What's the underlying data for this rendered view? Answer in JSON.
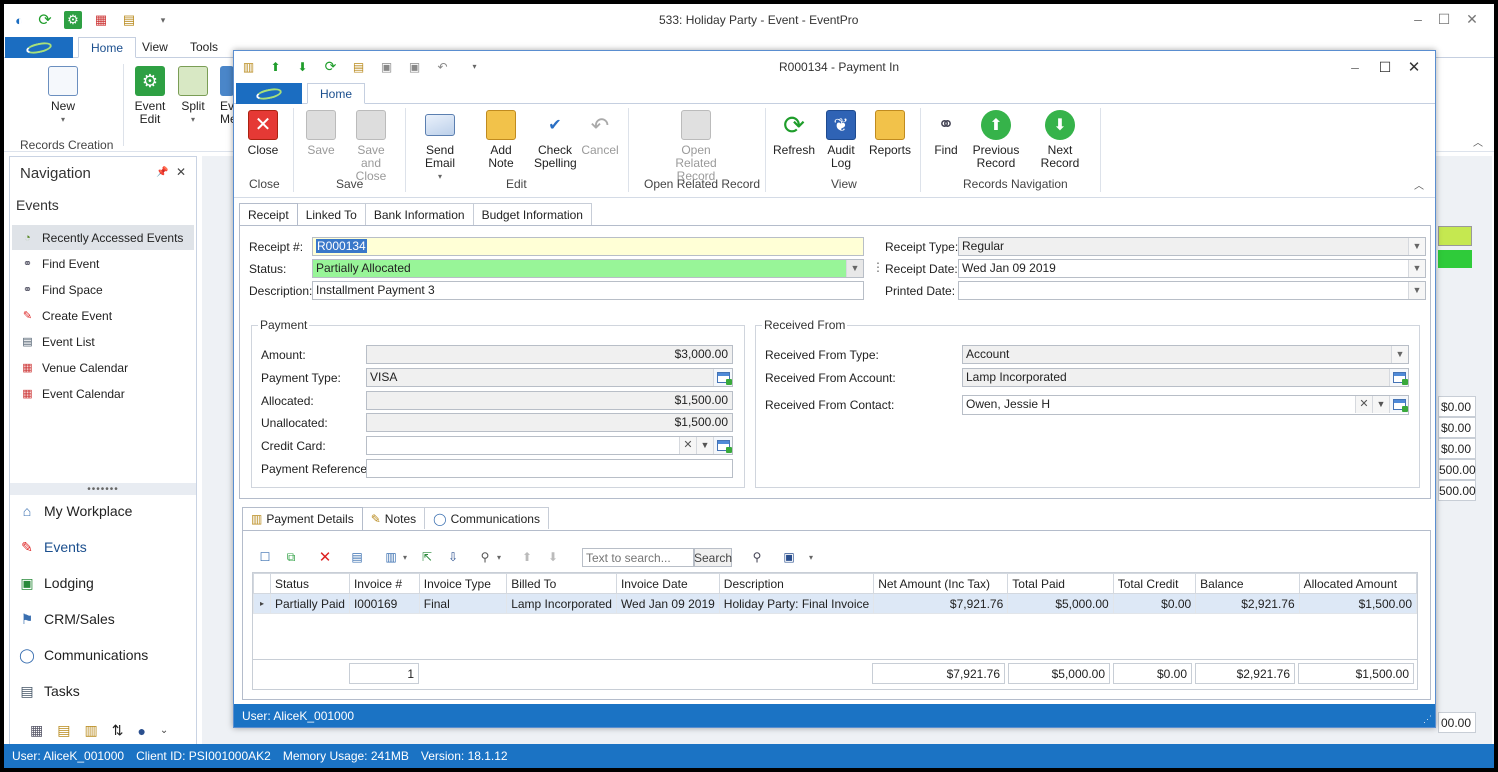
{
  "main_window": {
    "title": "533: Holiday Party - Event - EventPro",
    "tabs": [
      "Home",
      "View",
      "Tools"
    ],
    "ribbon": {
      "new_label": "New",
      "event_edit_label": "Event Edit",
      "split_label": "Split",
      "ev_partial_label": "Ev Me",
      "group_records_creation": "Records Creation"
    },
    "status": {
      "user": "User: AliceK_001000",
      "client": "Client ID: PSI001000AK2",
      "memory": "Memory Usage: 241MB",
      "version": "Version: 18.1.12"
    },
    "bg_values": [
      "$0.00",
      "$0.00",
      "$0.00",
      "500.00",
      "500.00",
      "00.00"
    ]
  },
  "navigation": {
    "title": "Navigation",
    "section": "Events",
    "items": [
      "Recently Accessed Events",
      "Find Event",
      "Find Space",
      "Create Event",
      "Event List",
      "Venue Calendar",
      "Event Calendar"
    ],
    "modules": [
      "My Workplace",
      "Events",
      "Lodging",
      "CRM/Sales",
      "Communications",
      "Tasks"
    ]
  },
  "dialog": {
    "title": "R000134 - Payment In",
    "tab_home": "Home",
    "ribbon": {
      "close": "Close",
      "save": "Save",
      "save_close": "Save and Close",
      "send_email": "Send Email",
      "add_note": "Add Note",
      "check_spelling": "Check Spelling",
      "cancel": "Cancel",
      "open_related": "Open Related Record",
      "refresh": "Refresh",
      "audit_log": "Audit Log",
      "reports": "Reports",
      "find": "Find",
      "previous_record": "Previous Record",
      "next_record": "Next Record",
      "groups": {
        "close": "Close",
        "save": "Save",
        "edit": "Edit",
        "open_related": "Open Related Record",
        "view": "View",
        "records_nav": "Records Navigation"
      }
    },
    "tabs": [
      "Receipt",
      "Linked To",
      "Bank Information",
      "Budget Information"
    ],
    "receipt": {
      "receipt_no_label": "Receipt #:",
      "receipt_no": "R000134",
      "status_label": "Status:",
      "status": "Partially Allocated",
      "description_label": "Description:",
      "description": "Installment Payment 3",
      "receipt_type_label": "Receipt Type:",
      "receipt_type": "Regular",
      "receipt_date_label": "Receipt Date:",
      "receipt_date": "Wed Jan 09 2019",
      "printed_date_label": "Printed Date:",
      "printed_date": ""
    },
    "payment": {
      "group": "Payment",
      "amount_label": "Amount:",
      "amount": "$3,000.00",
      "type_label": "Payment Type:",
      "type": "VISA",
      "allocated_label": "Allocated:",
      "allocated": "$1,500.00",
      "unallocated_label": "Unallocated:",
      "unallocated": "$1,500.00",
      "credit_card_label": "Credit Card:",
      "credit_card": "",
      "reference_label": "Payment Reference:",
      "reference": ""
    },
    "received_from": {
      "group": "Received From",
      "type_label": "Received From Type:",
      "type": "Account",
      "account_label": "Received From Account:",
      "account": "Lamp Incorporated",
      "contact_label": "Received From Contact:",
      "contact": "Owen, Jessie H"
    },
    "bottom_tabs": [
      "Payment Details",
      "Notes",
      "Communications"
    ],
    "search_placeholder": "Text to search...",
    "search_button": "Search",
    "grid": {
      "columns": [
        "Status",
        "Invoice #",
        "Invoice Type",
        "Billed To",
        "Invoice Date",
        "Description",
        "Net Amount (Inc Tax)",
        "Total Paid",
        "Total Credit",
        "Balance",
        "Allocated Amount"
      ],
      "rows": [
        [
          "Partially Paid",
          "I000169",
          "Final",
          "Lamp Incorporated",
          "Wed Jan 09 2019",
          "Holiday Party: Final Invoice",
          "$7,921.76",
          "$5,000.00",
          "$0.00",
          "$2,921.76",
          "$1,500.00"
        ]
      ],
      "totals": {
        "count": "1",
        "net": "$7,921.76",
        "paid": "$5,000.00",
        "credit": "$0.00",
        "balance": "$2,921.76",
        "allocated": "$1,500.00"
      }
    },
    "status_user": "User: AliceK_001000"
  },
  "colors": {
    "accent": "#1b73c4",
    "status_green": "#98f598",
    "receipt_yellow": "#ffffd6"
  }
}
